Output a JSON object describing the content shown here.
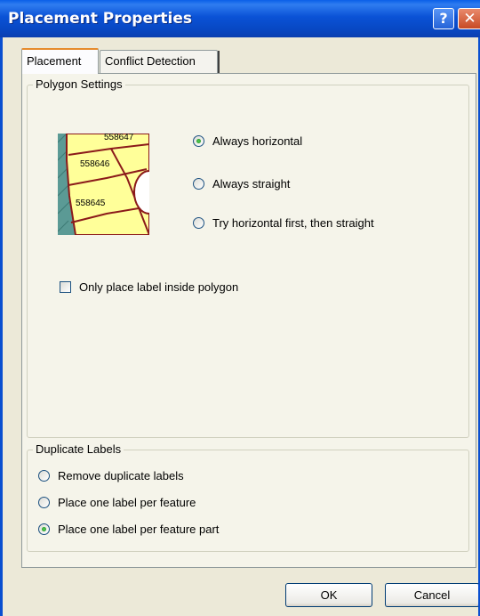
{
  "window": {
    "title": "Placement Properties",
    "help_glyph": "?",
    "close_glyph": "✕"
  },
  "tabs": [
    {
      "label": "Placement",
      "active": true
    },
    {
      "label": "Conflict Detection",
      "active": false
    }
  ],
  "polygon_settings": {
    "label": "Polygon Settings",
    "preview_labels": [
      "558647",
      "558646",
      "558645"
    ],
    "options": [
      {
        "label": "Always horizontal",
        "checked": true
      },
      {
        "label": "Always straight",
        "checked": false
      },
      {
        "label": "Try horizontal first, then straight",
        "checked": false
      }
    ],
    "inside_checkbox": {
      "label": "Only place label inside polygon",
      "checked": false
    }
  },
  "duplicate_labels": {
    "label": "Duplicate Labels",
    "options": [
      {
        "label": "Remove duplicate labels",
        "checked": false
      },
      {
        "label": "Place one label per feature",
        "checked": false
      },
      {
        "label": "Place one label per feature part",
        "checked": true
      }
    ]
  },
  "buttons": {
    "ok": "OK",
    "cancel": "Cancel"
  },
  "colors": {
    "title_bar": "#0a52d6",
    "dialog_bg": "#ece9d8",
    "polygon_fill": "#ffff99",
    "polygon_outline": "#8b1a1a",
    "water_fill": "#5b9a95"
  }
}
